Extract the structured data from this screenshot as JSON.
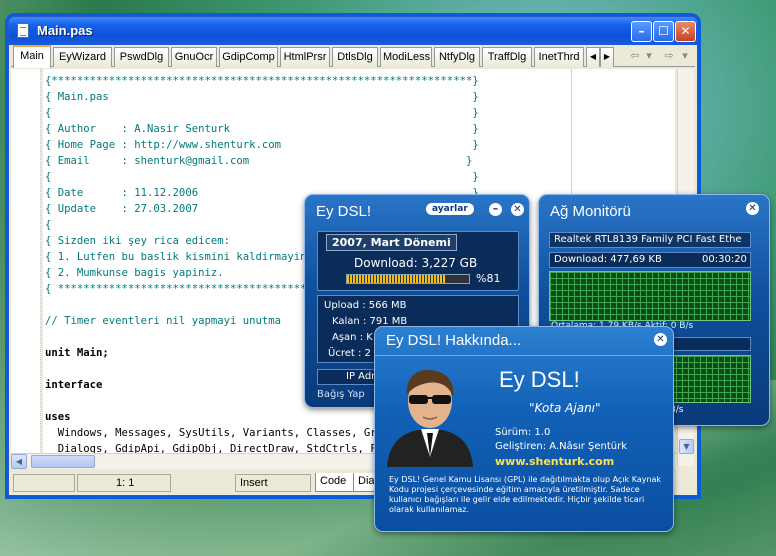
{
  "editor": {
    "title": "Main.pas",
    "window_buttons": {
      "minimize": "–",
      "maximize": "☐",
      "close": "✕"
    },
    "tabs": [
      "Main",
      "EyWizard",
      "PswdDlg",
      "GnuOcr",
      "GdipComp",
      "HtmlPrsr",
      "DtlsDlg",
      "ModiLess",
      "NtfyDlg",
      "TraffDlg",
      "InetThrd"
    ],
    "tab_scroll": {
      "left": "◀",
      "right": "▶"
    },
    "nav": {
      "back": "⇦",
      "forward": "⇨",
      "dropdown": "▾"
    },
    "code_lines": [
      {
        "text": "{******************************************************************}",
        "kind": "cm"
      },
      {
        "text": "{ Main.pas                                                         }",
        "kind": "cm"
      },
      {
        "text": "{                                                                  }",
        "kind": "cm"
      },
      {
        "text": "{ Author    : A.Nasir Senturk                                      }",
        "kind": "cm"
      },
      {
        "text": "{ Home Page : http://www.shenturk.com                              }",
        "kind": "cm"
      },
      {
        "text": "{ Email     : shenturk@gmail.com                                  }",
        "kind": "cm"
      },
      {
        "text": "{                                                                  }",
        "kind": "cm"
      },
      {
        "text": "{ Date      : 11.12.2006                                           }",
        "kind": "cm"
      },
      {
        "text": "{ Update    : 27.03.2007                                           }",
        "kind": "cm"
      },
      {
        "text": "{                                                                  }",
        "kind": "cm"
      },
      {
        "text": "{ Sizden iki şey rica edicem:                                      }",
        "kind": "cm"
      },
      {
        "text": "{ 1. Lutfen bu baslik kismini kaldirmayiniz.                       }",
        "kind": "cm"
      },
      {
        "text": "{ 2. Mumkunse bagis yapiniz.                                       }",
        "kind": "cm"
      },
      {
        "text": "{ ****************************************************************}",
        "kind": "cm"
      },
      {
        "text": "",
        "kind": "tx"
      },
      {
        "text": "// Timer eventleri nil yapmayi unutma",
        "kind": "cm"
      },
      {
        "text": "",
        "kind": "tx"
      },
      {
        "text": "unit Main;",
        "kind": "kw"
      },
      {
        "text": "",
        "kind": "tx"
      },
      {
        "text": "interface",
        "kind": "kw"
      },
      {
        "text": "",
        "kind": "tx"
      },
      {
        "text": "uses",
        "kind": "kw"
      },
      {
        "text": "  Windows, Messages, SysUtils, Variants, Classes, Graphics,",
        "kind": "tx"
      },
      {
        "text": "  Dialogs, GdipApi, GdipObj, DirectDraw, StdCtrls, Forms,",
        "kind": "tx"
      }
    ],
    "status": {
      "position": "1:   1",
      "mode": "Insert",
      "bottom_tabs": [
        "Code",
        "Diagram"
      ]
    }
  },
  "eydsl": {
    "title": "Ey DSL!",
    "settings_label": "ayarlar",
    "minimize": "–",
    "close": "✕",
    "period": "2007, Mart Dönemi",
    "download": "Download: 3,227 GB",
    "percent": "%81",
    "usage_fraction": 0.81,
    "rows": [
      {
        "label": "Upload",
        "value": "566 MB"
      },
      {
        "label": "Kalan",
        "value": "791 MB"
      },
      {
        "label": "Aşan",
        "value": "K"
      },
      {
        "label": "Ücret",
        "value": "2"
      }
    ],
    "ip_label": "IP Adr",
    "footer": "Bağış Yap"
  },
  "monitor": {
    "title": "Ağ Monitörü",
    "close": "✕",
    "adapter": "Realtek RTL8139 Family PCI Fast Ethe",
    "download": "Download: 477,69 KB",
    "time": "00:30:20",
    "ortalama": "Ortalama: 1,79 KB/s  Aktif: 0 B/s",
    "upload_rate": "0 B/s"
  },
  "about": {
    "title": "Ey DSL! Hakkında...",
    "close": "✕",
    "app_name": "Ey DSL!",
    "subtitle": "\"Kota Ajanı\"",
    "version": "Sürüm: 1.0",
    "developer": "Geliştiren: A.Nâsır Şentürk",
    "website": "www.shenturk.com",
    "license": "Ey DSL! Genel Kamu Lisansı (GPL) ile dağıtılmakta olup Açık Kaynak Kodu projesi çerçevesinde eğitim amacıyla üretilmiştir. Sadece kullanıcı bağışları ile gelir elde edilmektedir. Hiçbir şekilde ticari olarak kullanılamaz."
  }
}
